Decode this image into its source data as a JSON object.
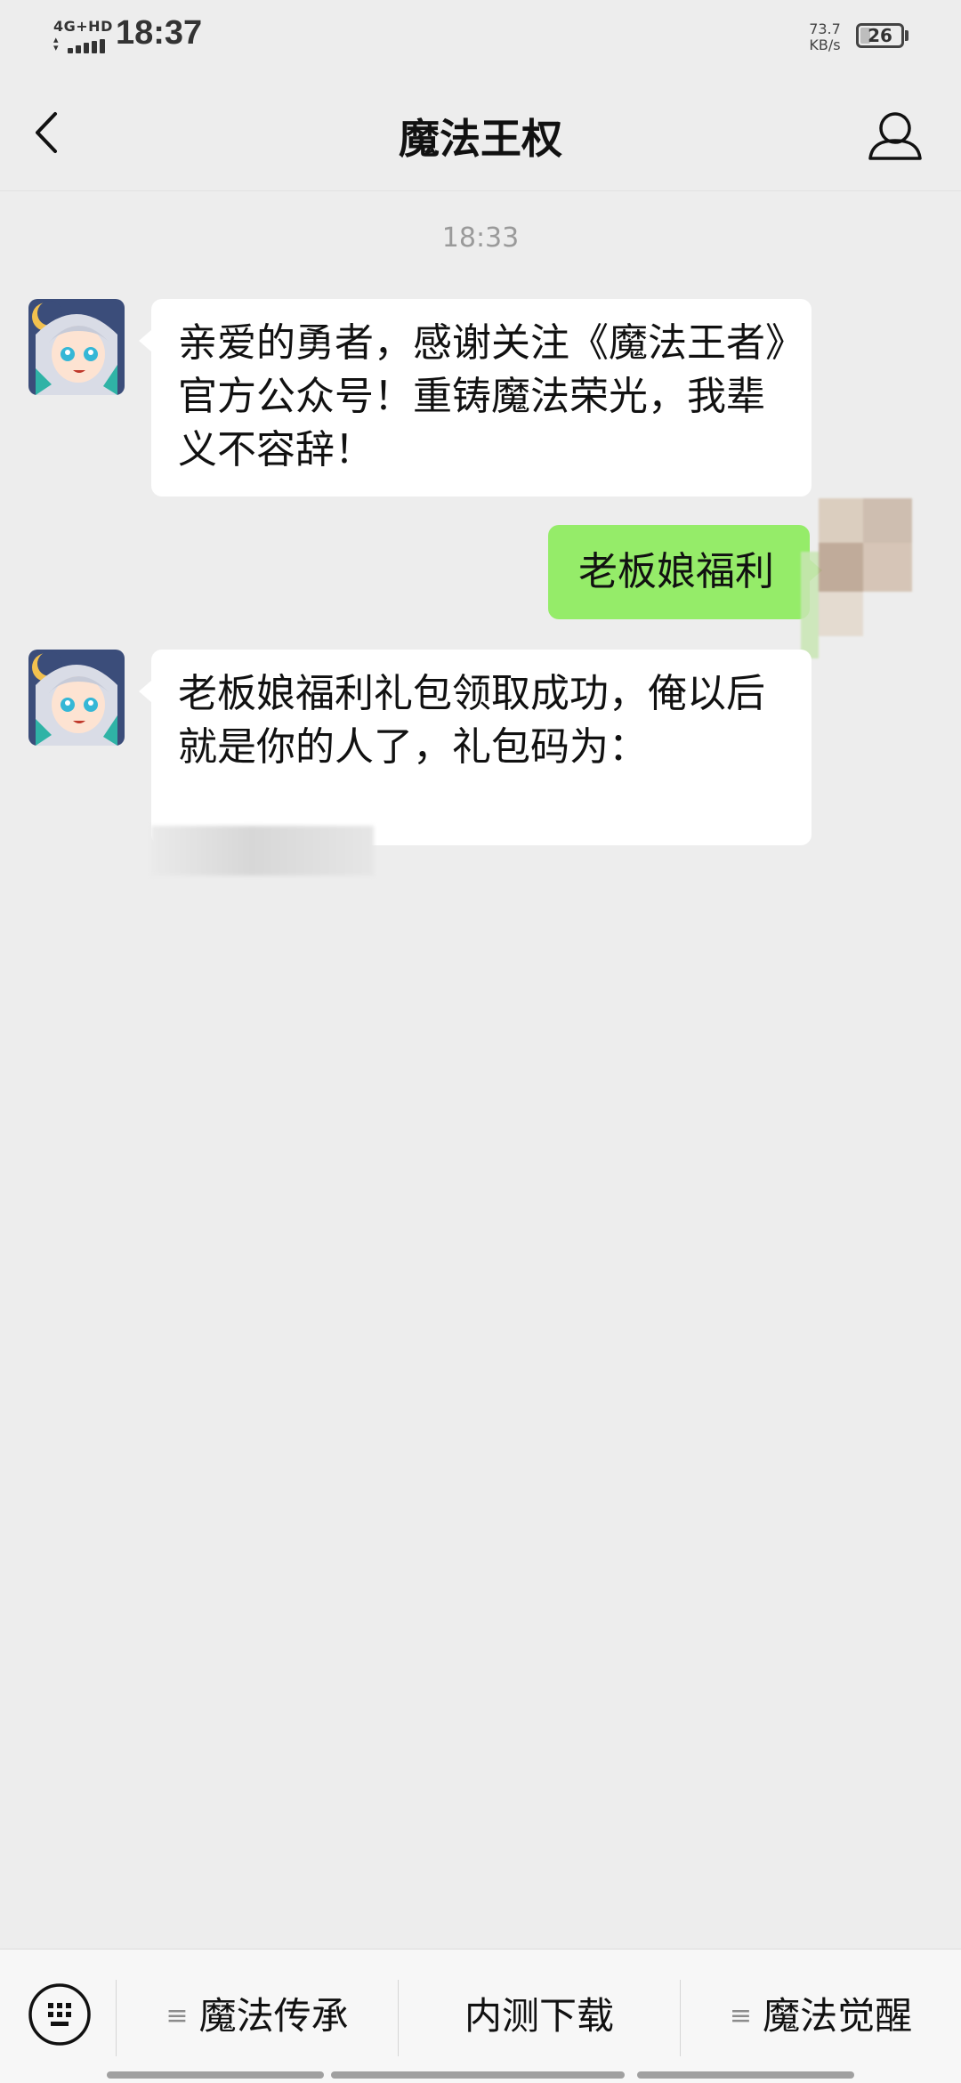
{
  "status_bar": {
    "network": "4G+HD",
    "time": "18:37",
    "speed_value": "73.7",
    "speed_unit": "KB/s",
    "battery_level": "26",
    "battery_fraction": 0.26
  },
  "header": {
    "title": "魔法王权",
    "back_icon": "chevron-left-icon",
    "profile_icon": "person-icon"
  },
  "chat": {
    "timestamp": "18:33",
    "messages": [
      {
        "direction": "incoming",
        "text": "亲爱的勇者，感谢关注《魔法王者》官方公众号！重铸魔法荣光，我辈义不容辞！"
      },
      {
        "direction": "outgoing",
        "text": "老板娘福利"
      },
      {
        "direction": "incoming",
        "text": "老板娘福利礼包领取成功，俺以后就是你的人了，礼包码为："
      }
    ]
  },
  "bottom_menu": {
    "keyboard_icon": "keyboard-icon",
    "items": [
      {
        "label": "魔法传承",
        "has_submenu": true
      },
      {
        "label": "内测下载",
        "has_submenu": false
      },
      {
        "label": "魔法觉醒",
        "has_submenu": true
      }
    ],
    "submenu_icon": "≡"
  },
  "colors": {
    "background": "#ededed",
    "incoming_bubble": "#ffffff",
    "outgoing_bubble": "#95ec69",
    "timestamp": "#9a9a9a"
  }
}
